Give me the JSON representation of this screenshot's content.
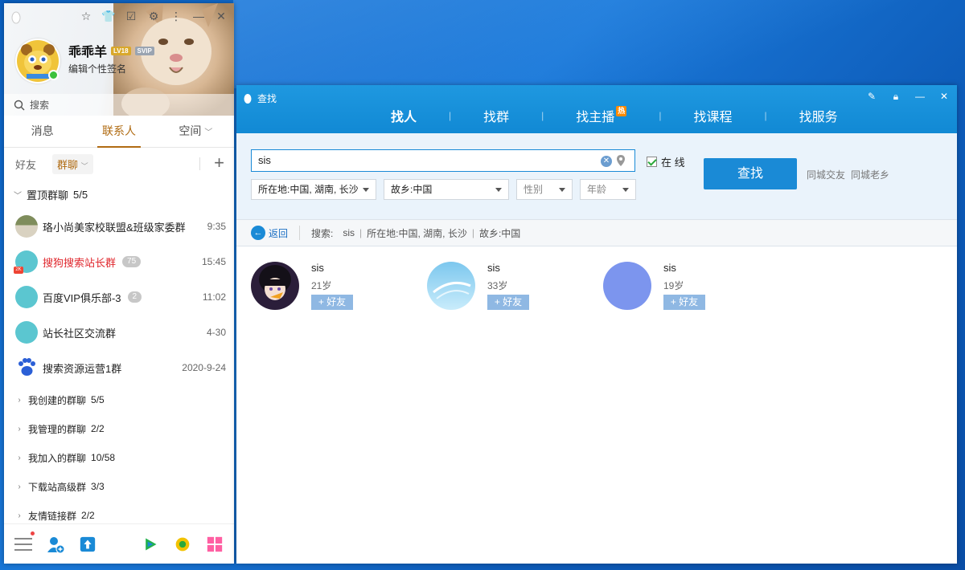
{
  "qq": {
    "nickname": "乖乖羊",
    "badge_level": "LV18",
    "badge_svip": "SVIP",
    "signature": "编辑个性签名",
    "search_placeholder": "搜索",
    "tabs": [
      "消息",
      "联系人",
      "空间"
    ],
    "subtabs": {
      "friends": "好友",
      "groups": "群聊"
    },
    "pinned": {
      "label": "置顶群聊",
      "count": "5/5"
    },
    "items": [
      {
        "name": "珞小尚美家校联盟&班级家委群",
        "time": "9:35",
        "badge": ""
      },
      {
        "name": "搜狗搜索站长群",
        "time": "15:45",
        "badge": "75"
      },
      {
        "name": "百度VIP俱乐部-3",
        "time": "11:02",
        "badge": "2"
      },
      {
        "name": "站长社区交流群",
        "time": "4-30",
        "badge": ""
      },
      {
        "name": "搜索资源运营1群",
        "time": "2020-9-24",
        "badge": ""
      }
    ],
    "folders": [
      {
        "label": "我创建的群聊",
        "count": "5/5"
      },
      {
        "label": "我管理的群聊",
        "count": "2/2"
      },
      {
        "label": "我加入的群聊",
        "count": "10/58"
      },
      {
        "label": "下载站高级群",
        "count": "3/3"
      },
      {
        "label": "友情链接群",
        "count": "2/2"
      }
    ]
  },
  "find": {
    "title": "查找",
    "tabs": [
      "找人",
      "找群",
      "找主播",
      "找课程",
      "找服务"
    ],
    "hot_badge": "热",
    "query": "sis",
    "online_label": "在 线",
    "location": "所在地:中国, 湖南, 长沙",
    "hometown": "故乡:中国",
    "gender": "性别",
    "age": "年龄",
    "search_button": "查找",
    "link_local": "同城交友",
    "link_hometown": "同城老乡",
    "back": "返回",
    "crumb_search_label": "搜索:",
    "crumb_query": "sis",
    "crumb_location": "所在地:中国, 湖南, 长沙",
    "crumb_hometown": "故乡:中国",
    "results": [
      {
        "name": "sis",
        "age": "21岁",
        "add": "+ 好友"
      },
      {
        "name": "sis",
        "age": "33岁",
        "add": "+ 好友"
      },
      {
        "name": "sis",
        "age": "19岁",
        "add": "+ 好友"
      }
    ]
  },
  "colors": {
    "accent": "#1a8ad6",
    "qq_active": "#b06b12",
    "unread_red": "#e0282e"
  }
}
